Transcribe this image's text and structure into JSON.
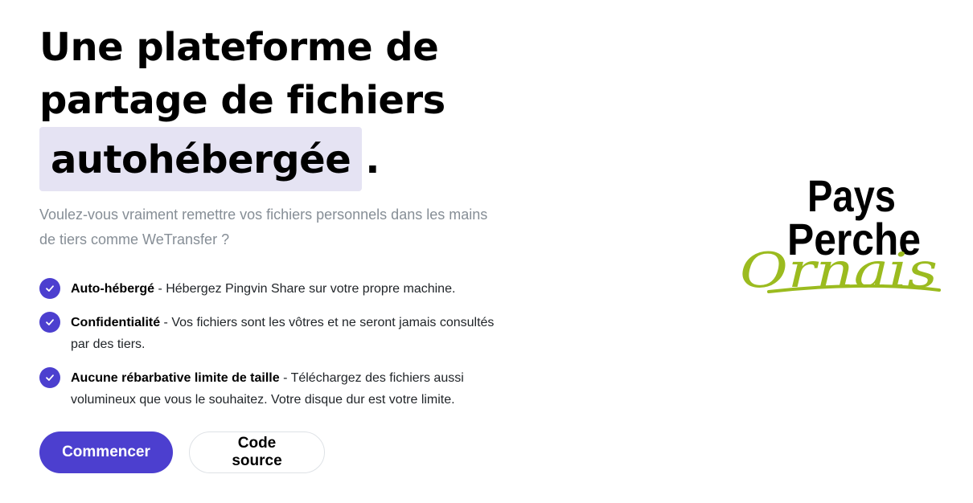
{
  "hero": {
    "title_line1": "Une plateforme de",
    "title_line2": "partage de fichiers",
    "title_highlight": "autohébergée",
    "title_end": ".",
    "subtitle": "Voulez-vous vraiment remettre vos fichiers personnels dans les mains de tiers comme WeTransfer ?"
  },
  "features": [
    {
      "title": "Auto-hébergé",
      "text": " - Hébergez Pingvin Share sur votre propre machine."
    },
    {
      "title": "Confidentialité",
      "text": " - Vos fichiers sont les vôtres et ne seront jamais consultés par des tiers."
    },
    {
      "title": "Aucune rébarbative limite de taille",
      "text": " - Téléchargez des fichiers aussi volumineux que vous le souhaitez. Votre disque dur est votre limite."
    }
  ],
  "buttons": {
    "primary_label": "Commencer",
    "secondary_label": "Code source"
  },
  "logo": {
    "line1": "Pays",
    "line2": "Perche",
    "line3": "Ornais",
    "accent_color": "#9bbb1f"
  },
  "colors": {
    "accent": "#4c3fcf",
    "highlight_bg": "#e5e3f3",
    "subtitle": "#868e96"
  },
  "icons": {
    "feature_check": "check-icon"
  }
}
